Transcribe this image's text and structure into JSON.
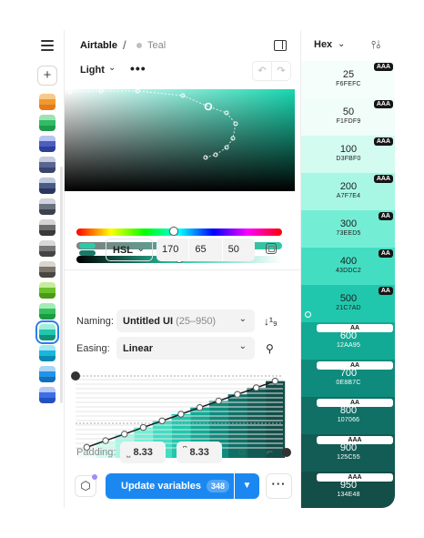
{
  "header": {
    "app": "Airtable",
    "separator": "/",
    "palette": "Teal"
  },
  "toolbar": {
    "theme": "Light",
    "more": "•••",
    "undo": "↶",
    "redo": "↷"
  },
  "sidebar": {
    "swatches": [
      [
        "#f7c98a",
        "#f0992f",
        "#e57a1a"
      ],
      [
        "#9fe3b3",
        "#2ebd65",
        "#1e9a4f"
      ],
      [
        "#b7c3f0",
        "#4b5fbf",
        "#2d3f9a"
      ],
      [
        "#c6cbe0",
        "#5a6590",
        "#3a4470"
      ],
      [
        "#c2c8dc",
        "#4a5a86",
        "#2a3660"
      ],
      [
        "#cfd3dc",
        "#6a7280",
        "#3c424d"
      ],
      [
        "#d4d4d4",
        "#6c6c6c",
        "#3a3a3a"
      ],
      [
        "#d8d8d8",
        "#777777",
        "#444444"
      ],
      [
        "#d9d5cf",
        "#7b756c",
        "#4a463f"
      ],
      [
        "#c6ec9a",
        "#6cc02d",
        "#4a9a18"
      ],
      [
        "#a6eab8",
        "#2fc25c",
        "#1c9a43"
      ],
      [
        "#9ff0da",
        "#21c7ad",
        "#12917c"
      ],
      [
        "#a5e6f5",
        "#19b6dc",
        "#0a8ab0"
      ],
      [
        "#a9d6f7",
        "#2493e6",
        "#126fc0"
      ],
      [
        "#b5c6f7",
        "#3c6ee8",
        "#2551c0"
      ]
    ],
    "selected_index": 11
  },
  "color": {
    "model": "HSL",
    "h": "170",
    "s": "65",
    "l": "50"
  },
  "naming": {
    "label": "Naming:",
    "value": "Untitled UI",
    "range": "(25–950)"
  },
  "easing": {
    "label": "Easing:",
    "value": "Linear"
  },
  "padding": {
    "label": "Padding:",
    "left": "8.33",
    "right": "8.33"
  },
  "actions": {
    "update": "Update variables",
    "count": "348"
  },
  "shades_header": {
    "format": "Hex"
  },
  "shades": [
    {
      "num": "25",
      "hex": "F6FEFC",
      "bg": "#f6fefc",
      "fg": "#1f1f1f",
      "tag": "AAA",
      "tag_style": "dark"
    },
    {
      "num": "50",
      "hex": "F1FDF9",
      "bg": "#f1fdf9",
      "fg": "#1f1f1f",
      "tag": "AAA",
      "tag_style": "dark"
    },
    {
      "num": "100",
      "hex": "D3FBF0",
      "bg": "#d3fbf0",
      "fg": "#1f1f1f",
      "tag": "AAA",
      "tag_style": "dark"
    },
    {
      "num": "200",
      "hex": "A7F7E4",
      "bg": "#a7f7e4",
      "fg": "#1f1f1f",
      "tag": "AAA",
      "tag_style": "dark"
    },
    {
      "num": "300",
      "hex": "73EED5",
      "bg": "#73eed5",
      "fg": "#1f1f1f",
      "tag": "AA",
      "tag_style": "dark"
    },
    {
      "num": "400",
      "hex": "43DDC2",
      "bg": "#43ddc2",
      "fg": "#1f1f1f",
      "tag": "AA",
      "tag_style": "dark"
    },
    {
      "num": "500",
      "hex": "21C7AD",
      "bg": "#21c7ad",
      "fg": "#1f1f1f",
      "tag": "AA",
      "tag_style": "dark"
    },
    {
      "num": "600",
      "hex": "12AA95",
      "bg": "#12aa95",
      "fg": "#ffffff",
      "tag": "AA",
      "tag_style": "light"
    },
    {
      "num": "700",
      "hex": "0E8B7C",
      "bg": "#0e8b7c",
      "fg": "#ffffff",
      "tag": "AA",
      "tag_style": "light"
    },
    {
      "num": "800",
      "hex": "107066",
      "bg": "#107066",
      "fg": "#ffffff",
      "tag": "AA",
      "tag_style": "light"
    },
    {
      "num": "900",
      "hex": "125C55",
      "bg": "#125c55",
      "fg": "#ffffff",
      "tag": "AAA",
      "tag_style": "light"
    },
    {
      "num": "950",
      "hex": "134E48",
      "bg": "#134e48",
      "fg": "#ffffff",
      "tag": "AAA",
      "tag_style": "light"
    }
  ],
  "accent": "#1b88f2"
}
